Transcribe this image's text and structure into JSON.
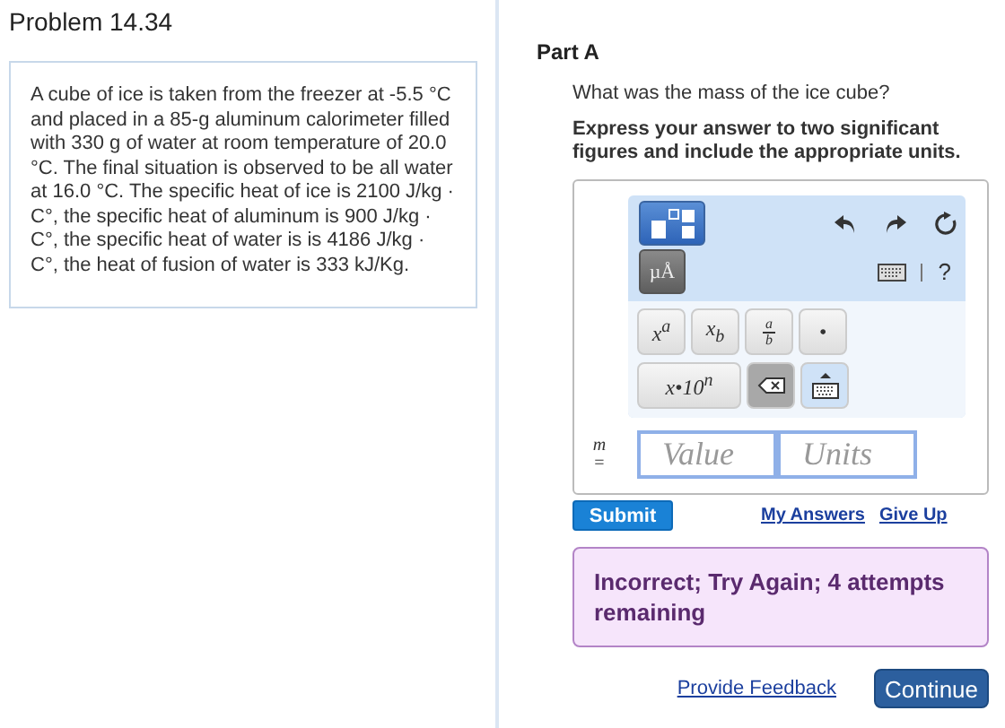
{
  "problem": {
    "title": "Problem 14.34",
    "text": "A cube of ice is taken from the freezer at -5.5 °C and placed in a 85-g aluminum calorimeter filled with 330  g of water at room temperature of 20.0 °C. The final situation is observed to be all water at 16.0 °C. The specific heat of ice is 2100 J/kg · C°, the specific heat of aluminum is 900 J/kg · C°, the specific heat of water is is 4186 J/kg · C°, the heat of fusion of water is 333 kJ/Kg."
  },
  "part": {
    "title": "Part A",
    "question": "What was the mass of the ice cube?",
    "instruction": "Express your answer to two significant figures and include the appropriate units."
  },
  "toolbar": {
    "units_button": "µÅ",
    "help": "?",
    "keys": [
      {
        "kind": "text",
        "label": "x$^{a}$"
      },
      {
        "kind": "text",
        "label": "x$_{b}$"
      },
      {
        "kind": "fraction",
        "numerator": "a",
        "denominator": "b"
      },
      {
        "kind": "text",
        "label": "•"
      }
    ],
    "keys2": [
      {
        "kind": "text",
        "label": "x•10$^{n}$"
      },
      {
        "kind": "backspace"
      },
      {
        "kind": "keyboard"
      }
    ]
  },
  "answer": {
    "variable": "m",
    "equals": "=",
    "value_placeholder": "Value",
    "units_placeholder": "Units"
  },
  "actions": {
    "submit": "Submit",
    "links": [
      "My Answers",
      "Give Up"
    ]
  },
  "feedback": "Incorrect; Try Again; 4 attempts remaining",
  "footer": {
    "link": "Provide Feedback",
    "button": "Continue"
  }
}
